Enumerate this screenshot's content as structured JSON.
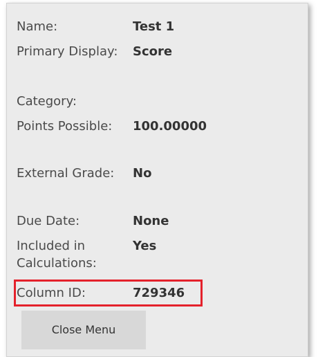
{
  "details": [
    {
      "label": "Name:",
      "value": "Test 1"
    },
    {
      "label": "Primary Display:",
      "value": "Score"
    },
    {
      "label": "Category:",
      "value": ""
    },
    {
      "label": "Points Possible:",
      "value": "100.00000"
    },
    {
      "label": "External Grade:",
      "value": "No"
    },
    {
      "label": "Due Date:",
      "value": "None"
    },
    {
      "label": "Included in Calculations:",
      "value": "Yes"
    },
    {
      "label": "Column ID:",
      "value": "729346"
    }
  ],
  "close_button_label": "Close Menu",
  "highlight_color": "#e4212b"
}
